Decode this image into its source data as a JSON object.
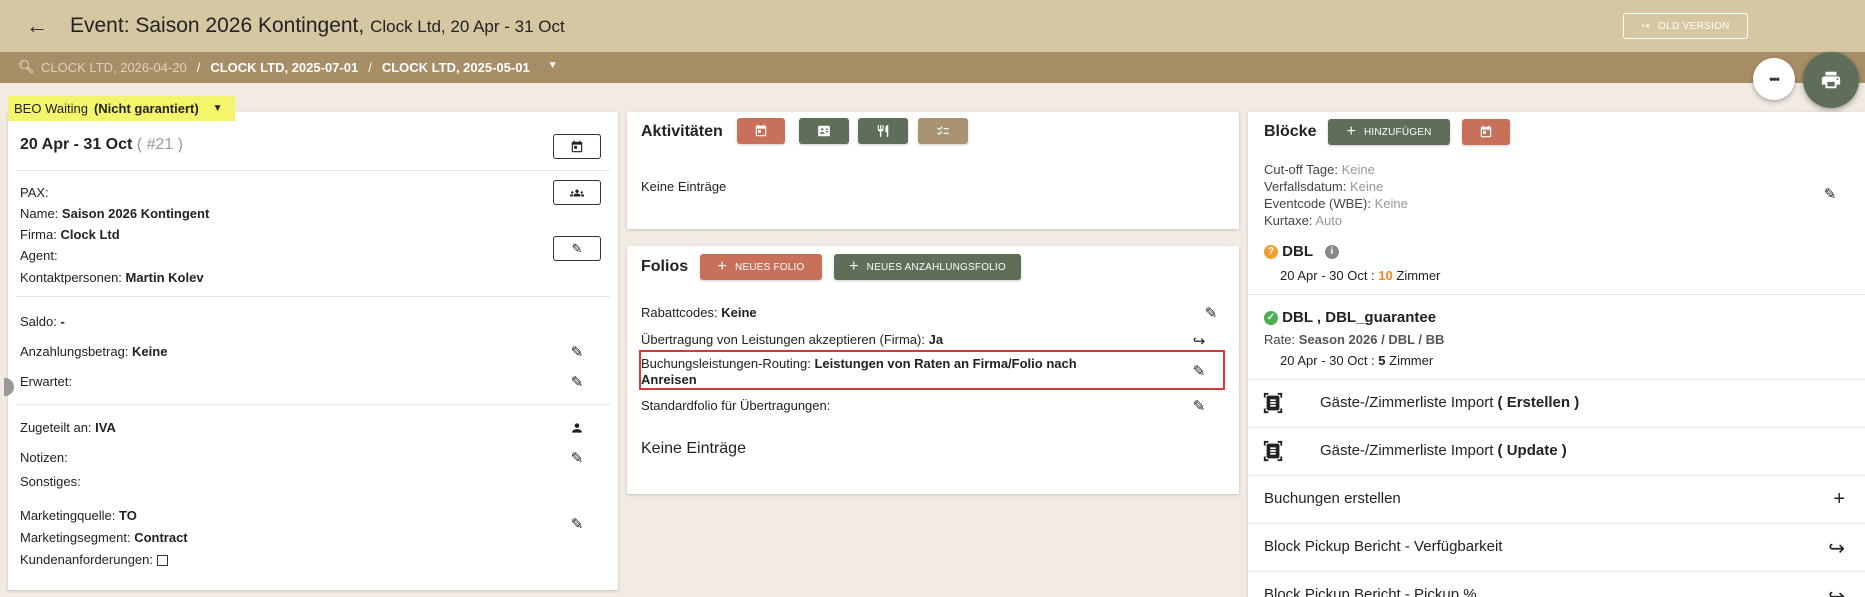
{
  "header": {
    "title": "Event: Saison 2026 Kontingent,",
    "subtitle": "Clock Ltd, 20 Apr - 31 Oct",
    "old_version_label": "OLD VERSION"
  },
  "breadcrumb": {
    "items": [
      "CLOCK LTD, 2026-04-20",
      "CLOCK LTD, 2025-07-01",
      "CLOCK LTD, 2025-05-01"
    ],
    "sep": "/"
  },
  "fab": {
    "more": "•••"
  },
  "status": {
    "label": "BEO Waiting",
    "value": "(Nicht garantiert)"
  },
  "left": {
    "date_range": "20 Apr - 31 Oct",
    "event_number": "( #21 )",
    "pax_label": "PAX:",
    "name_label": "Name:",
    "name_value": "Saison 2026 Kontingent",
    "firma_label": "Firma:",
    "firma_value": "Clock Ltd",
    "agent_label": "Agent:",
    "kontakt_label": "Kontaktpersonen:",
    "kontakt_value": "Martin Kolev",
    "saldo_label": "Saldo:",
    "saldo_value": "-",
    "anzahlung_label": "Anzahlungsbetrag:",
    "anzahlung_value": "Keine",
    "erwartet_label": "Erwartet:",
    "zugeteilt_label": "Zugeteilt an:",
    "zugeteilt_value": "IVA",
    "notizen_label": "Notizen:",
    "sonstiges_label": "Sonstiges:",
    "mquelle_label": "Marketingquelle:",
    "mquelle_value": "TO",
    "msegment_label": "Marketingsegment:",
    "msegment_value": "Contract",
    "kunden_label": "Kundenanforderungen:"
  },
  "activities": {
    "title": "Aktivitäten",
    "empty": "Keine Einträge"
  },
  "folios": {
    "title": "Folios",
    "new_folio": "NEUES FOLIO",
    "new_deposit_folio": "NEUES ANZAHLUNGSFOLIO",
    "rabatt_label": "Rabattcodes:",
    "rabatt_value": "Keine",
    "uebertragung_label": "Übertragung von Leistungen akzeptieren (Firma):",
    "uebertragung_value": "Ja",
    "routing_label": "Buchungsleistungen-Routing:",
    "routing_value_1": "Leistungen von Raten an Firma/Folio nach",
    "routing_value_2": "Anreisen",
    "standard_label": "Standardfolio für Übertragungen:",
    "empty": "Keine Einträge"
  },
  "blocks": {
    "title": "Blöcke",
    "add": "HINZUFÜGEN",
    "cutoff_label": "Cut-off Tage:",
    "cutoff_value": "Keine",
    "verfall_label": "Verfallsdatum:",
    "verfall_value": "Keine",
    "eventcode_label": "Eventcode (WBE):",
    "eventcode_value": "Keine",
    "kurtaxe_label": "Kurtaxe:",
    "kurtaxe_value": "Auto",
    "block1_name": "DBL",
    "block1_range": "20 Apr - 30 Oct :",
    "block1_rooms": "10",
    "block1_unit": "Zimmer",
    "block2_name": "DBL , DBL_guarantee",
    "block2_rate_label": "Rate:",
    "block2_rate_value": "Season 2026 / DBL / BB",
    "block2_range": "20 Apr - 30 Oct :",
    "block2_rooms": "5",
    "block2_unit": "Zimmer",
    "import1_label": "Gäste-/Zimmerliste Import",
    "import1_action": "( Erstellen )",
    "import2_label": "Gäste-/Zimmerliste Import",
    "import2_action": "( Update )",
    "buchungen_label": "Buchungen erstellen",
    "pickup1_label": "Block Pickup Bericht - Verfügbarkeit",
    "pickup2_label": "Block Pickup Bericht - Pickup %"
  },
  "colors": {
    "header": "#d6c7a3",
    "breadcrumb": "#a88e67",
    "accent_red": "#c8705a",
    "accent_green": "#5f6e58",
    "badge": "#f5f56b",
    "highlight": "#d9383a"
  }
}
